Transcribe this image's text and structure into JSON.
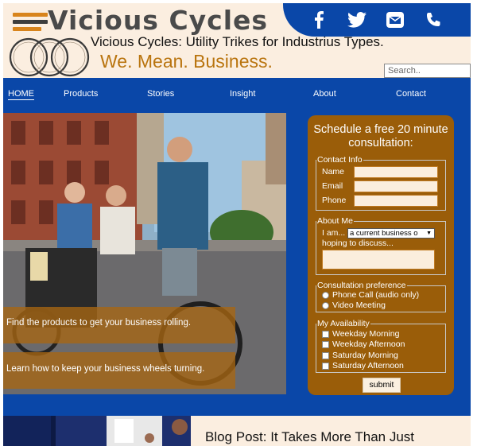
{
  "header": {
    "brand": "Vicious Cycles",
    "tagline": "Vicious Cycles: Utility Trikes for Industrius Types.",
    "slogan": "We. Mean. Business.",
    "search_placeholder": "Search..",
    "social_icons": [
      "facebook-icon",
      "twitter-icon",
      "email-icon",
      "phone-icon"
    ]
  },
  "nav": {
    "items": [
      "HOME",
      "Products",
      "Stories",
      "Insight",
      "About",
      "Contact"
    ],
    "active": "HOME"
  },
  "hero": {
    "cta_products": "Find the products to get your business rolling.",
    "cta_stories": "Learn how to keep your business wheels turning."
  },
  "form": {
    "title": "Schedule a free 20 minute consultation:",
    "contact": {
      "legend": "Contact Info",
      "name_label": "Name",
      "email_label": "Email",
      "phone_label": "Phone"
    },
    "about": {
      "legend": "About Me",
      "i_am_label": "I am...",
      "i_am_selected": "a current business o",
      "hoping_label": "hoping to discuss..."
    },
    "preference": {
      "legend": "Consultation preference",
      "options": [
        "Phone Call (audio only)",
        "Video Meeting"
      ]
    },
    "availability": {
      "legend": "My Availability",
      "options": [
        "Weekday Morning",
        "Weekday Afternoon",
        "Saturday Morning",
        "Saturday Afternoon"
      ]
    },
    "submit_label": "submit"
  },
  "blog": {
    "title": "Blog Post: It Takes More Than Just"
  },
  "colors": {
    "primary_blue": "#0a47a8",
    "accent_orange": "#9a5d09",
    "cream": "#fbeee0",
    "slogan_orange": "#b9740e"
  }
}
